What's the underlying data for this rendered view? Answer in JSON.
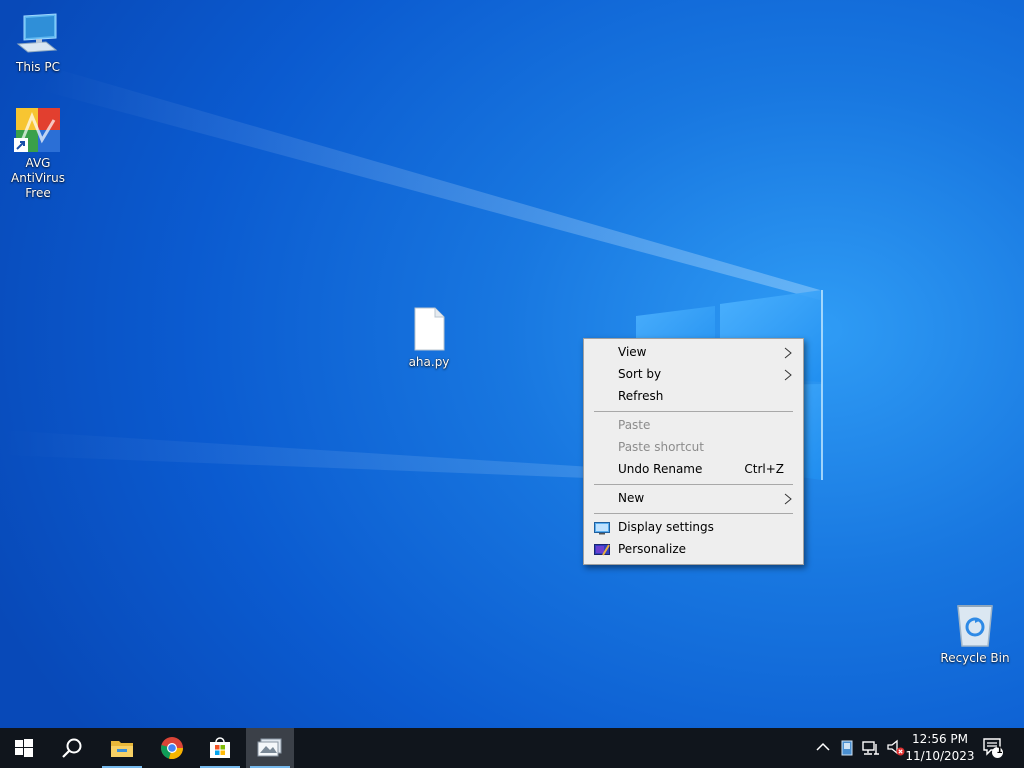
{
  "desktop": {
    "icons": [
      {
        "label": "This PC"
      },
      {
        "label": "AVG AntiVirus Free"
      },
      {
        "label": "aha.py"
      },
      {
        "label": "Recycle Bin"
      }
    ]
  },
  "context_menu": {
    "view": "View",
    "sort_by": "Sort by",
    "refresh": "Refresh",
    "paste": "Paste",
    "paste_shortcut": "Paste shortcut",
    "undo_rename": "Undo Rename",
    "undo_shortcut": "Ctrl+Z",
    "new": "New",
    "display_settings": "Display settings",
    "personalize": "Personalize"
  },
  "taskbar": {
    "apps": [
      "start-icon",
      "search-icon",
      "file-explorer-icon",
      "chrome-icon",
      "microsoft-store-icon",
      "screenshot-app-icon"
    ],
    "time": "12:56 PM",
    "date": "11/10/2023",
    "notification_count": "1"
  },
  "colors": {
    "desktop_bg": "#0b5bd0",
    "taskbar_bg": "#10151c",
    "menu_bg": "#eeeeee",
    "disabled_text": "#8c8c8c"
  }
}
